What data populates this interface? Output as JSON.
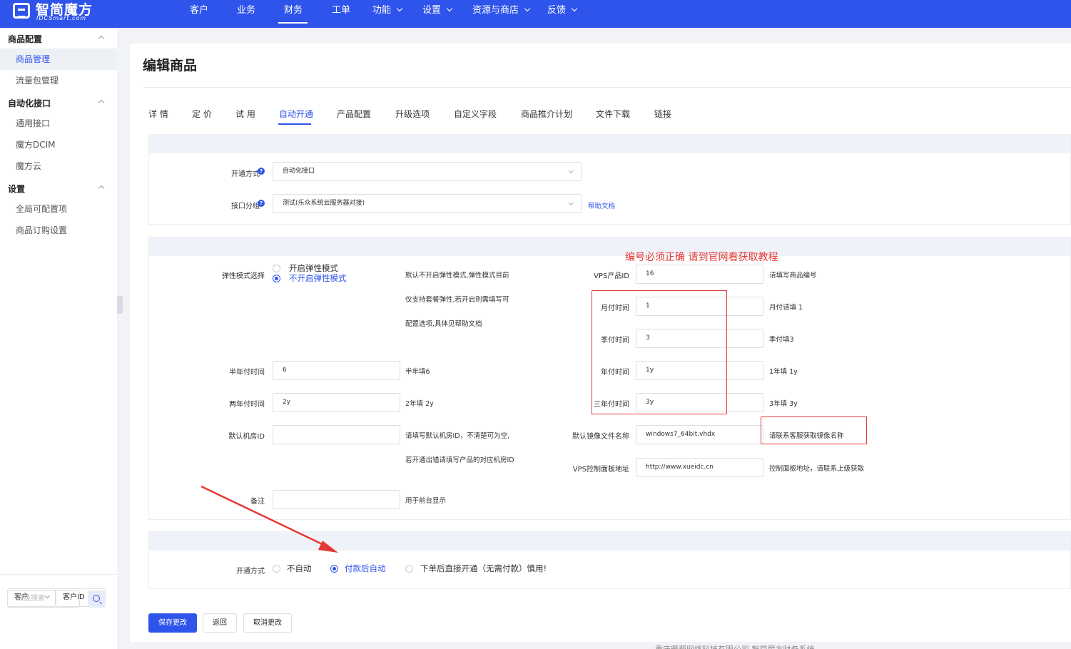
{
  "brand": {
    "name": "智简魔方",
    "sub": "IDCSmart.com"
  },
  "nav": [
    {
      "label": "客户"
    },
    {
      "label": "业务"
    },
    {
      "label": "财务"
    },
    {
      "label": "工单"
    },
    {
      "label": "功能"
    },
    {
      "label": "设置"
    },
    {
      "label": "资源与商店"
    },
    {
      "label": "反馈"
    }
  ],
  "sidebar": {
    "groups": [
      {
        "title": "商品配置",
        "items": [
          "商品管理",
          "流量包管理"
        ]
      },
      {
        "title": "自动化接口",
        "items": [
          "通用接口",
          "魔方DCIM",
          "魔方云"
        ]
      },
      {
        "title": "设置",
        "items": [
          "全局可配置项",
          "商品订购设置"
        ]
      }
    ],
    "active_item": "商品管理",
    "search": {
      "type_select": "客户",
      "field_select": "客户ID",
      "placeholder": "高级搜索"
    }
  },
  "page": {
    "title": "编辑商品"
  },
  "tabs": [
    "详 情",
    "定 价",
    "试 用",
    "自动开通",
    "产品配置",
    "升级选项",
    "自定义字段",
    "商品推介计划",
    "文件下载",
    "链接"
  ],
  "active_tab": "自动开通",
  "provision": {
    "method_label": "开通方式",
    "method_value": "自动化接口",
    "group_label": "接口分组",
    "group_value": "测试(乐众系统云服务器对接)",
    "help_link": "帮助文档"
  },
  "config": {
    "elastic_label": "弹性模式选择",
    "elastic_options": [
      "开启弹性模式",
      "不开启弹性模式"
    ],
    "elastic_selected": "不开启弹性模式",
    "elastic_hint": [
      "默认不开启弹性模式,弹性模式目前",
      "仅支持套餐弹性,若开启则需填写可",
      "配置选项,具体见帮助文档"
    ],
    "half_year_label": "半年付时间",
    "half_year_value": "6",
    "half_year_hint": "半年填6",
    "two_year_label": "两年付时间",
    "two_year_value": "2y",
    "two_year_hint": "2年填 2y",
    "room_label": "默认机房ID",
    "room_value": "",
    "room_hint": [
      "请填写默认机房ID，不清楚可为空,",
      "若开通出错请填写产品的对应机房ID"
    ],
    "remark_label": "备注",
    "remark_value": "",
    "remark_hint": "用于前台显示",
    "vps_id_label": "VPS产品ID",
    "vps_id_value": "16",
    "vps_id_hint": "请填写商品编号",
    "monthly_label": "月付时间",
    "monthly_value": "1",
    "monthly_hint": "月付请填 1",
    "quarterly_label": "季付时间",
    "quarterly_value": "3",
    "quarterly_hint": "季付填3",
    "yearly_label": "年付时间",
    "yearly_value": "1y",
    "yearly_hint": "1年填 1y",
    "three_year_label": "三年付时间",
    "three_year_value": "3y",
    "three_year_hint": "3年填 3y",
    "image_label": "默认镜像文件名称",
    "image_value": "windows7_64bit.vhdx",
    "image_hint": "请联系客服获取镜像名称",
    "panel_label": "VPS控制面板地址",
    "panel_value": "http://www.xueidc.cn",
    "panel_hint": "控制面板地址，请联系上级获取",
    "annotation": "编号必须正确 请到官网看获取教程"
  },
  "open_mode": {
    "label": "开通方式",
    "options": [
      "不自动",
      "付款后自动",
      "下单后直接开通（无需付款）慎用!"
    ],
    "selected": "付款后自动"
  },
  "actions": {
    "save": "保存更改",
    "back": "返回",
    "cancel": "取消更改"
  },
  "footer_text": "重庆暖帮网络科技有限公司 智简魔方财务系统",
  "colors": {
    "primary": "#2f54eb",
    "annotation_red": "#e53935",
    "panel_header": "#eff2f9"
  }
}
